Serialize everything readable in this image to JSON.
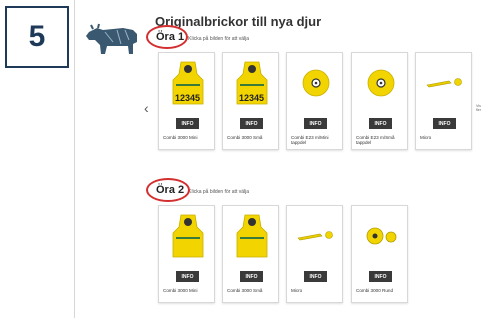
{
  "step": {
    "number": "5"
  },
  "thumbnail": {
    "icon": "cow-icon"
  },
  "page": {
    "title": "Originalbrickor till nya djur"
  },
  "carousel": {
    "prev_label": "‹",
    "side_note": "Vis fler"
  },
  "sections": [
    {
      "title": "Öra 1",
      "hint": "Klicka på bilden för att välja",
      "products": [
        {
          "image": "tag-large-icon",
          "number": "12345",
          "info_label": "INFO",
          "name": "Combi 3000 Mini"
        },
        {
          "image": "tag-large-icon",
          "number": "12345",
          "info_label": "INFO",
          "name": "Combi 3000 Små"
        },
        {
          "image": "tag-round-icon",
          "info_label": "INFO",
          "name": "Combi E23 m/Mini tappdel"
        },
        {
          "image": "tag-round-icon",
          "info_label": "INFO",
          "name": "Combi E23 m/Små tappdel"
        },
        {
          "image": "tag-micro-icon",
          "info_label": "INFO",
          "name": "Micro"
        }
      ]
    },
    {
      "title": "Öra 2",
      "hint": "Klicka på bilden för att välja",
      "products": [
        {
          "image": "tag-large-icon",
          "info_label": "INFO",
          "name": "Combi 3000 Mini"
        },
        {
          "image": "tag-large-icon",
          "info_label": "INFO",
          "name": "Combi 3000 Små"
        },
        {
          "image": "tag-micro-icon",
          "info_label": "INFO",
          "name": "Micro"
        },
        {
          "image": "tag-button-icon",
          "info_label": "INFO",
          "name": "Combi 3000 Rund"
        }
      ]
    }
  ],
  "colors": {
    "badge": "#1f3a58",
    "tag": "#f2d400",
    "highlight": "#d32f2f",
    "info_button": "#3a3a3a"
  }
}
